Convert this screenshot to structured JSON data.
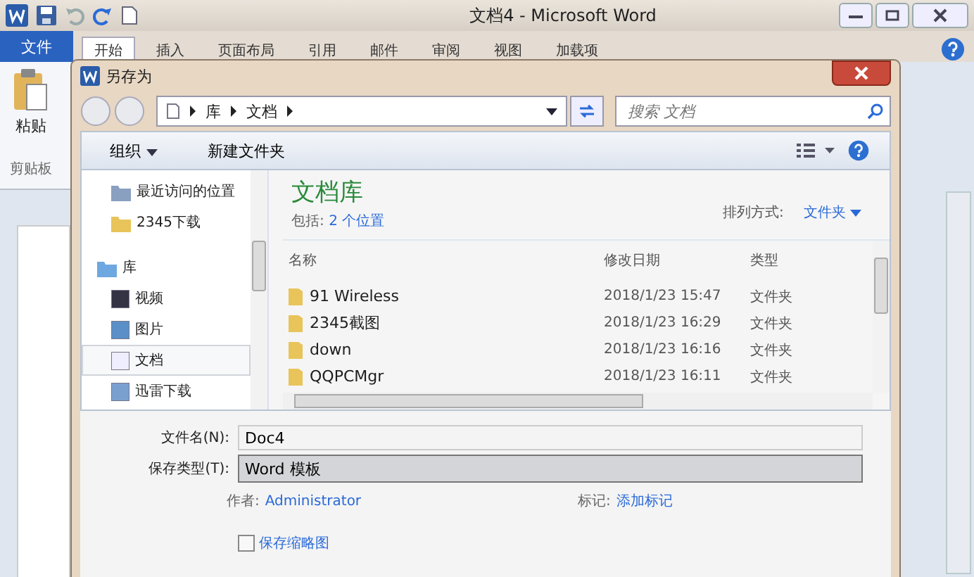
{
  "window": {
    "title": "文档4 - Microsoft Word"
  },
  "ribbon": {
    "file_tab": "文件",
    "tabs": [
      {
        "label": "开始",
        "selected": true
      },
      {
        "label": "插入",
        "selected": false
      },
      {
        "label": "页面布局",
        "selected": false
      },
      {
        "label": "引用",
        "selected": false
      },
      {
        "label": "邮件",
        "selected": false
      },
      {
        "label": "审阅",
        "selected": false
      },
      {
        "label": "视图",
        "selected": false
      },
      {
        "label": "加载项",
        "selected": false
      }
    ],
    "paste_label": "粘贴",
    "group_label": "剪贴板"
  },
  "dialog": {
    "title": "另存为",
    "breadcrumb": [
      "库",
      "文档"
    ],
    "search": {
      "placeholder": "搜索 文档"
    },
    "toolbar": {
      "organize": "组织",
      "new_folder": "新建文件夹"
    },
    "nav": [
      {
        "label": "最近访问的位置",
        "kind": "recent",
        "selected": false
      },
      {
        "label": "2345下载",
        "kind": "folder",
        "selected": false
      },
      {
        "label": "库",
        "kind": "library",
        "selected": false,
        "children": [
          {
            "label": "视频",
            "kind": "video",
            "selected": false
          },
          {
            "label": "图片",
            "kind": "image",
            "selected": false
          },
          {
            "label": "文档",
            "kind": "doc",
            "selected": true
          },
          {
            "label": "迅雷下载",
            "kind": "download",
            "selected": false
          }
        ]
      }
    ],
    "library": {
      "title": "文档库",
      "includes_label": "包括:",
      "includes_link": "2 个位置",
      "sort_label": "排列方式:",
      "sort_value": "文件夹"
    },
    "columns": [
      "名称",
      "修改日期",
      "类型"
    ],
    "rows": [
      {
        "name": "91 Wireless",
        "date": "2018/1/23 15:47",
        "type": "文件夹"
      },
      {
        "name": "2345截图",
        "date": "2018/1/23 16:29",
        "type": "文件夹"
      },
      {
        "name": "down",
        "date": "2018/1/23 16:16",
        "type": "文件夹"
      },
      {
        "name": "QQPCMgr",
        "date": "2018/1/23 16:11",
        "type": "文件夹"
      }
    ],
    "filename": {
      "label": "文件名(N):",
      "value": "Doc4"
    },
    "filetype": {
      "label": "保存类型(T):",
      "value": "Word 模板"
    },
    "author": {
      "label": "作者:",
      "value": "Administrator"
    },
    "tags": {
      "label": "标记:",
      "value": "添加标记"
    },
    "thumbnail": {
      "label": "保存缩略图",
      "checked": false
    }
  }
}
